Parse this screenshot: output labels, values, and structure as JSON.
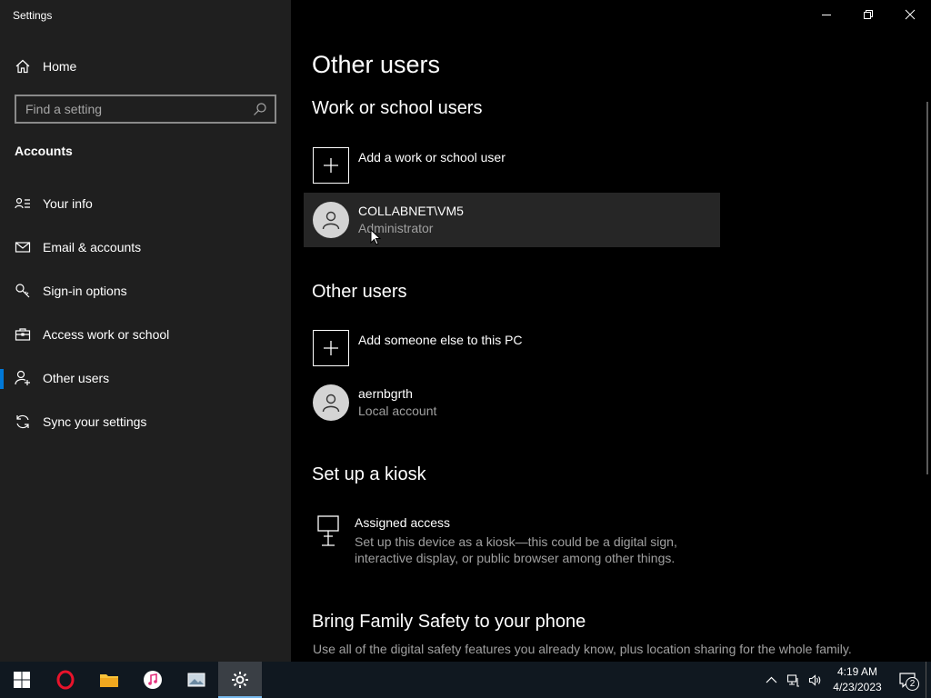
{
  "app": {
    "title": "Settings"
  },
  "sidebar": {
    "home_label": "Home",
    "search_placeholder": "Find a setting",
    "section": "Accounts",
    "items": [
      {
        "label": "Your info",
        "icon": "person-card-icon"
      },
      {
        "label": "Email & accounts",
        "icon": "mail-icon"
      },
      {
        "label": "Sign-in options",
        "icon": "key-icon"
      },
      {
        "label": "Access work or school",
        "icon": "briefcase-icon"
      },
      {
        "label": "Other users",
        "icon": "person-add-icon",
        "active": true
      },
      {
        "label": "Sync your settings",
        "icon": "sync-icon"
      }
    ]
  },
  "main": {
    "title": "Other users",
    "work_section": {
      "heading": "Work or school users",
      "add_label": "Add a work or school user",
      "user": {
        "name": "COLLABNET\\VM5",
        "role": "Administrator"
      }
    },
    "other_section": {
      "heading": "Other users",
      "add_label": "Add someone else to this PC",
      "user": {
        "name": "aernbgrth",
        "role": "Local account"
      }
    },
    "kiosk_section": {
      "heading": "Set up a kiosk",
      "title": "Assigned access",
      "description": "Set up this device as a kiosk—this could be a digital sign, interactive display, or public browser among other things."
    },
    "family_section": {
      "heading": "Bring Family Safety to your phone",
      "description": "Use all of the digital safety features you already know, plus location sharing for the whole family."
    }
  },
  "taskbar": {
    "apps": [
      "start-icon",
      "opera-icon",
      "file-explorer-icon",
      "itunes-icon",
      "photos-icon",
      "settings-icon"
    ],
    "clock": {
      "time": "4:19 AM",
      "date": "4/23/2023"
    },
    "notification_count": "2"
  },
  "colors": {
    "accent": "#0078d7",
    "sidebar_bg": "#1f1f1f",
    "main_bg": "#000000",
    "taskbar_bg": "#101820"
  }
}
